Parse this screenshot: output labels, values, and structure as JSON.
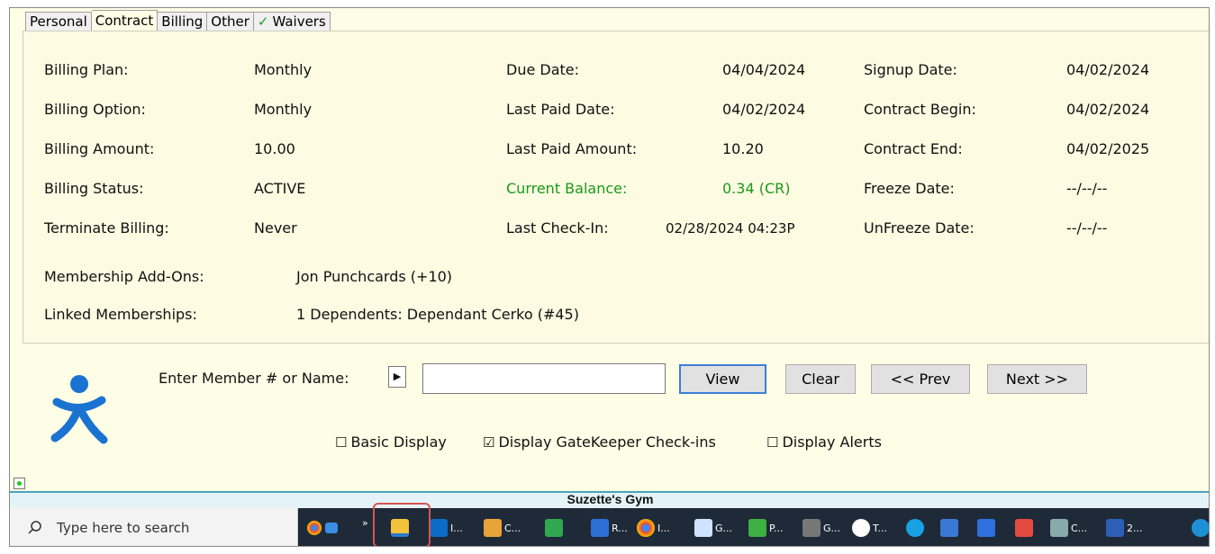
{
  "tabs": [
    {
      "label": "Personal"
    },
    {
      "label": "Contract"
    },
    {
      "label": "Billing"
    },
    {
      "label": "Other"
    },
    {
      "label": "Waivers"
    }
  ],
  "contract": {
    "billing_plan_label": "Billing Plan:",
    "billing_plan": "Monthly",
    "billing_option_label": "Billing Option:",
    "billing_option": "Monthly",
    "billing_amount_label": "Billing Amount:",
    "billing_amount": "10.00",
    "billing_status_label": "Billing Status:",
    "billing_status": "ACTIVE",
    "terminate_billing_label": "Terminate Billing:",
    "terminate_billing": "Never",
    "due_date_label": "Due Date:",
    "due_date": "04/04/2024",
    "last_paid_date_label": "Last Paid Date:",
    "last_paid_date": "04/02/2024",
    "last_paid_amount_label": "Last Paid Amount:",
    "last_paid_amount": "10.20",
    "current_balance_label": "Current Balance:",
    "current_balance": "0.34 (CR)",
    "last_checkin_label": "Last Check-In:",
    "last_checkin": "02/28/2024 04:23P",
    "signup_date_label": "Signup Date:",
    "signup_date": "04/02/2024",
    "contract_begin_label": "Contract Begin:",
    "contract_begin": "04/02/2024",
    "contract_end_label": "Contract End:",
    "contract_end": "04/02/2025",
    "freeze_date_label": "Freeze Date:",
    "freeze_date": "--/--/--",
    "unfreeze_date_label": "UnFreeze Date:",
    "unfreeze_date": "--/--/--",
    "addons_label": "Membership Add-Ons:",
    "addons": "Jon Punchcards (+10)",
    "linked_label": "Linked Memberships:",
    "linked": "1 Dependents: Dependant Cerko (#45)"
  },
  "lookup": {
    "label": "Enter Member # or Name:",
    "input_value": "",
    "view": "View",
    "clear": "Clear",
    "prev": "<< Prev",
    "next": "Next >>"
  },
  "options": {
    "basic_display": "Basic Display",
    "basic_display_checked": false,
    "gatekeeper": "Display GateKeeper Check-ins",
    "gatekeeper_checked": true,
    "alerts": "Display Alerts",
    "alerts_checked": false
  },
  "gym_name": "Suzette's Gym",
  "taskbar": {
    "search_placeholder": "Type here to search",
    "items": [
      "I...",
      "C...",
      "R...",
      "I...",
      "G...",
      "P...",
      "G...",
      "T...",
      "C...",
      "2..."
    ]
  },
  "colors": {
    "balance": "#1a9a1a",
    "panel": "#fdfbe2",
    "taskbar": "#1f2a38",
    "highlight": "#d9534f"
  }
}
